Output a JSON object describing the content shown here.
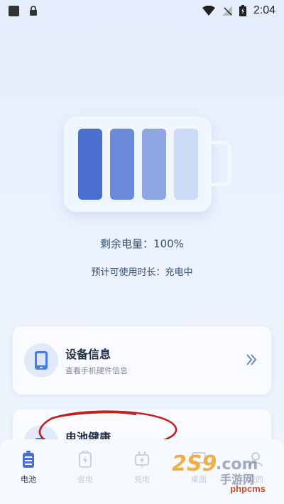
{
  "status_bar": {
    "time": "2:04"
  },
  "battery": {
    "remaining_label": "剩余电量：100%",
    "estimate_label": "预计可使用时长：充电中",
    "level_percent": 100
  },
  "cards": [
    {
      "title": "设备信息",
      "subtitle": "查看手机硬件信息"
    },
    {
      "title": "电池健康"
    }
  ],
  "tabs": [
    {
      "label": "电池",
      "icon": "battery-icon",
      "active": true
    },
    {
      "label": "省电",
      "icon": "power-save-icon",
      "active": false
    },
    {
      "label": "充电",
      "icon": "charging-icon",
      "active": false
    },
    {
      "label": "桌面",
      "icon": "desktop-icon",
      "active": false
    },
    {
      "label": "我的",
      "icon": "profile-icon",
      "active": false
    }
  ],
  "watermark": {
    "brand": "2S9.com",
    "brand_cn": "手游网",
    "site": "phpcms"
  },
  "colors": {
    "accent": "#4a6fd0",
    "cell_1": "#4a6fd0",
    "cell_2": "#6b8ad9",
    "cell_3": "#8ea7e2",
    "cell_4": "#ccdaf3",
    "annotation": "#c21f1f"
  }
}
